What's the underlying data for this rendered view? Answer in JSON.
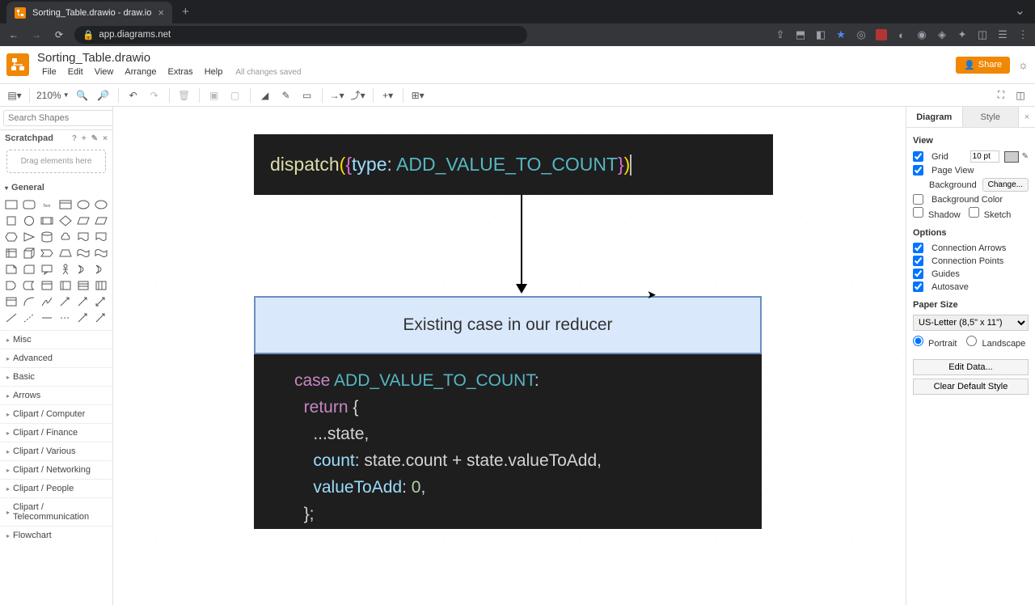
{
  "browser": {
    "tab_title": "Sorting_Table.drawio - draw.io",
    "url": "app.diagrams.net"
  },
  "app": {
    "doc_title": "Sorting_Table.drawio",
    "menubar": [
      "File",
      "Edit",
      "View",
      "Arrange",
      "Extras",
      "Help"
    ],
    "changes_saved": "All changes saved",
    "share_label": "Share"
  },
  "toolbar": {
    "zoom": "210%"
  },
  "left": {
    "search_placeholder": "Search Shapes",
    "scratchpad_label": "Scratchpad",
    "scratchpad_drop": "Drag elements here",
    "general_label": "General",
    "categories": [
      "Misc",
      "Advanced",
      "Basic",
      "Arrows",
      "Clipart / Computer",
      "Clipart / Finance",
      "Clipart / Various",
      "Clipart / Networking",
      "Clipart / People",
      "Clipart / Telecommunication",
      "Flowchart"
    ]
  },
  "canvas": {
    "dispatch_fn": "dispatch",
    "dispatch_key": "type",
    "dispatch_type": "ADD_VALUE_TO_COUNT",
    "label": "Existing case in our reducer",
    "code_case": "case",
    "code_const": "ADD_VALUE_TO_COUNT",
    "code_return": "return",
    "code_l1": "...state,",
    "code_l2_a": "count",
    "code_l2_b": ": state.count + state.valueToAdd,",
    "code_l3_a": "valueToAdd",
    "code_l3_b": ": ",
    "code_l3_c": "0",
    "code_l3_d": ",",
    "code_l4": "};"
  },
  "right": {
    "tabs": {
      "diagram": "Diagram",
      "style": "Style"
    },
    "view_label": "View",
    "grid_label": "Grid",
    "grid_size": "10 pt",
    "page_view_label": "Page View",
    "background_label": "Background",
    "change_label": "Change...",
    "bg_color_label": "Background Color",
    "shadow_label": "Shadow",
    "sketch_label": "Sketch",
    "options_label": "Options",
    "conn_arrows_label": "Connection Arrows",
    "conn_points_label": "Connection Points",
    "guides_label": "Guides",
    "autosave_label": "Autosave",
    "paper_size_label": "Paper Size",
    "paper_size_value": "US-Letter (8,5\" x 11\")",
    "portrait_label": "Portrait",
    "landscape_label": "Landscape",
    "edit_data_label": "Edit Data...",
    "clear_style_label": "Clear Default Style"
  }
}
